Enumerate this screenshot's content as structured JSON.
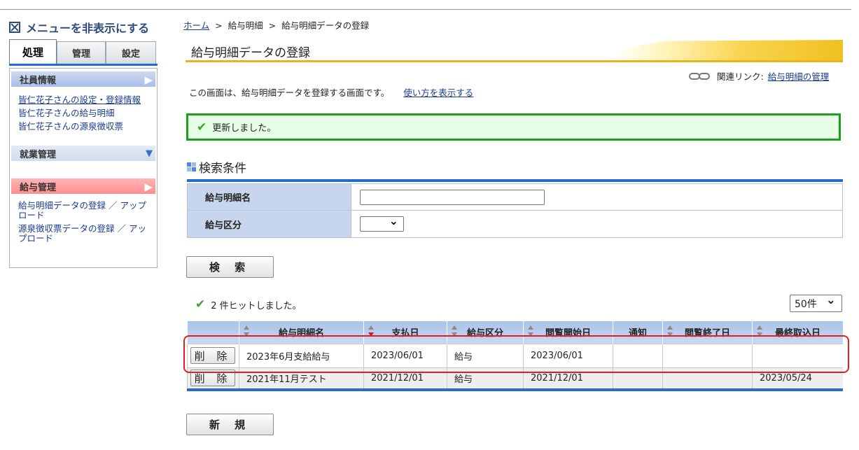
{
  "sidebar": {
    "hide_menu": "メニューを非表示にする",
    "tabs": [
      "処理",
      "管理",
      "設定"
    ],
    "employee_info": "社員情報",
    "employee_links": [
      "皆仁花子さんの設定・登録情報",
      "皆仁花子さんの給与明細",
      "皆仁花子さんの源泉徴収票"
    ],
    "work_mgmt": "就業管理",
    "payroll_mgmt": "給与管理",
    "payroll_links": [
      "給与明細データの登録 ／ アップロード",
      "源泉徴収票データの登録 ／ アップロード"
    ]
  },
  "breadcrumb": {
    "home": "ホーム",
    "sep": ">",
    "item1": "給与明細",
    "item2": "給与明細データの登録"
  },
  "page_title": "給与明細データの登録",
  "related": {
    "label": "関連リンク:",
    "link": "給与明細の管理"
  },
  "description": {
    "text": "この画面は、給与明細データを登録する画面です。",
    "link": "使い方を表示する"
  },
  "message": "更新しました。",
  "search": {
    "title": "検索条件",
    "name_label": "給与明細名",
    "name_value": "",
    "type_label": "給与区分",
    "type_value": "",
    "button": "検 索"
  },
  "results": {
    "hit_text": "2 件ヒットしました。",
    "per_page": "50件",
    "columns": [
      "給与明細名",
      "支払日",
      "給与区分",
      "閲覧開始日",
      "通知",
      "閲覧終了日",
      "最終取込日"
    ],
    "rows": [
      {
        "action": "削 除",
        "name": "2023年6月支給給与",
        "pay_date": "2023/06/01",
        "type": "給与",
        "view_start": "2023/06/01",
        "notice": "",
        "view_end": "",
        "last_import": ""
      },
      {
        "action": "削 除",
        "name": "2021年11月テスト",
        "pay_date": "2021/12/01",
        "type": "給与",
        "view_start": "2021/12/01",
        "notice": "",
        "view_end": "",
        "last_import": "2023/05/24"
      }
    ]
  },
  "new_button": "新 規",
  "colors": {
    "accent_blue": "#1f6ed0",
    "success_green": "#1ea01e",
    "title_yellow": "#e9b516",
    "highlight_red": "#e02020"
  }
}
